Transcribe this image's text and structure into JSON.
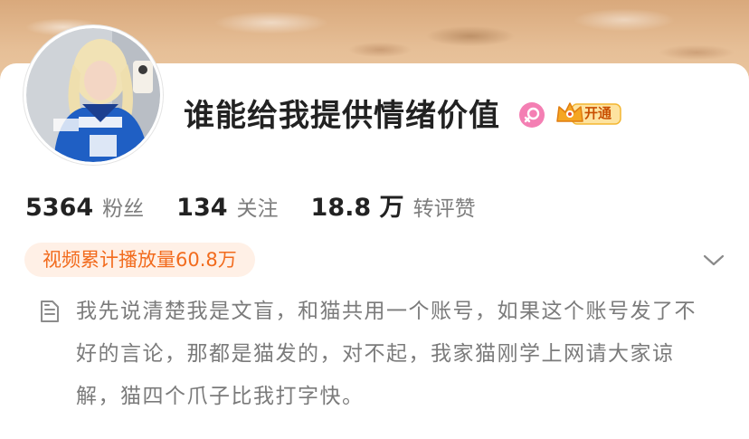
{
  "profile": {
    "name": "谁能给我提供情绪价值",
    "vip_label": "开通",
    "stats": [
      {
        "value": "5364",
        "label": "粉丝"
      },
      {
        "value": "134",
        "label": "关注"
      },
      {
        "value": "18.8 万",
        "label": "转评赞"
      }
    ],
    "views_chip": "视频累计播放量60.8万",
    "bio": "我先说清楚我是文盲，和猫共用一个账号，如果这个账号发了不好的言论，那都是猫发的，对不起，我家猫刚学上网请大家谅解，猫四个爪子比我打字快。"
  },
  "icons": {
    "gender": "female-icon",
    "vip": "vip-crown-icon",
    "expand": "chevron-down-icon",
    "bio": "document-icon"
  },
  "colors": {
    "gender_bg": "#f47fb3",
    "chip_bg": "#fff0e6",
    "chip_text": "#f26b1d",
    "vip_gold": "#f7c23a"
  }
}
